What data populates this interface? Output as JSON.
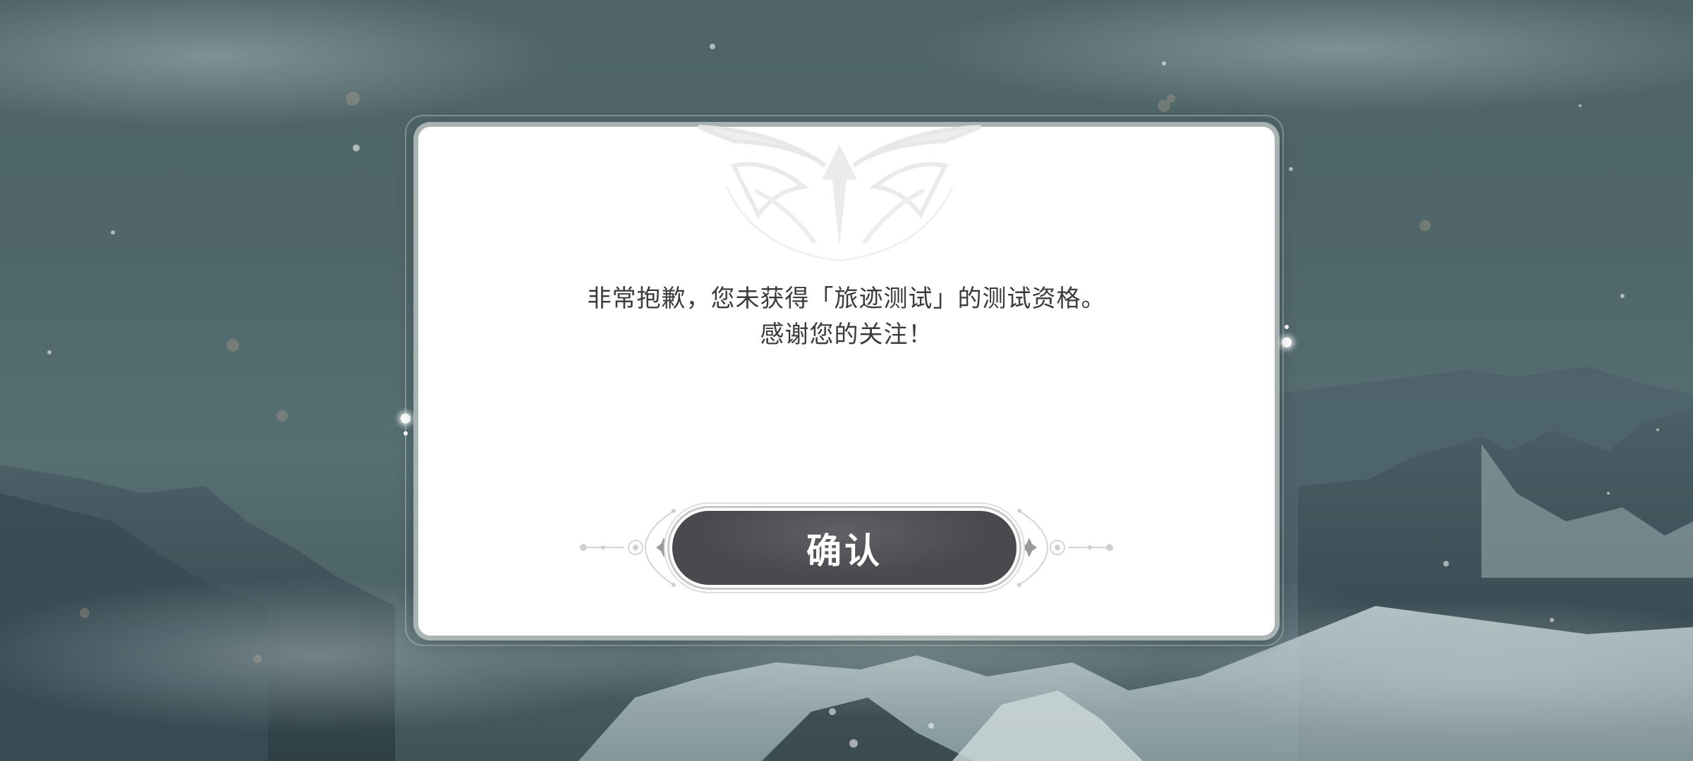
{
  "dialog": {
    "message_line1": "非常抱歉，您未获得「旅迹测试」的测试资格。",
    "message_line2": "感谢您的关注！",
    "confirm_label": "确认"
  },
  "colors": {
    "background": "#50676a",
    "dialog": "#ffffff",
    "dialog_border": "#a9b3b2",
    "text": "#3b3b3d",
    "button": "#4a494e",
    "button_text": "#ffffff"
  },
  "icons": {
    "emblem": "winged-crest-emblem",
    "button_ornament": "star-dot-ornament"
  }
}
